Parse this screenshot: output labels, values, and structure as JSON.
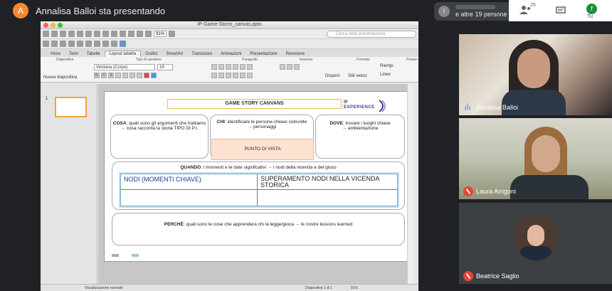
{
  "topbar": {
    "presenter_initial": "A",
    "presenter_text": "Annalisa Balloi sta presentando"
  },
  "app": {
    "window_title": "IP-Game-Storm_canvas.pptx",
    "zoom": "91%",
    "search_placeholder": "Cerca nella presentazione",
    "tabs": [
      "Inizio",
      "Temi",
      "Tabelle",
      "Layout tabella",
      "Grafici",
      "SmartArt",
      "Transizioni",
      "Animazioni",
      "Presentazione",
      "Revisione"
    ],
    "active_tab_index": 3,
    "ribbon": {
      "group_diapositive": "Diapositive",
      "group_carattere": "Tipo di carattere",
      "group_paragrafo": "Paragrafo",
      "group_inserisci": "Inserisci",
      "group_formato": "Formato",
      "group_presenta": "Presen",
      "font_name": "Verdana (Corpo)",
      "font_size": "19",
      "nuova_label": "Nuova diapositiva",
      "disponi_label": "Disponi",
      "stili_label": "Stili veloci",
      "riempi_label": "Riempi",
      "linee_label": "Linee"
    },
    "status": {
      "view": "Visualizzazione normale",
      "slide": "Diapositiva 1 di 1",
      "zoom": "91%"
    },
    "thumb_number": "1"
  },
  "slide": {
    "title": "GAME STORY CANVANS",
    "logo_line1": "IP",
    "logo_line2": "EXPERIENCE",
    "cosa_label": "COSA",
    "cosa_text": ": quali sono gli argomenti che trattiamo",
    "cosa_text2": "→ cosa racconta la storia TIPO DI P.I.",
    "chi_label": "CHI",
    "chi_text": ": identificare le persone chiave coinvolte",
    "chi_text2": "→ personaggi",
    "punto_di_vista": "PUNTO DI VISTA",
    "dove_label": "DOVE",
    "dove_text": ": trovare i luoghi chiave",
    "dove_text2": "→ ambientazione",
    "quando_label": "QUANDO",
    "quando_text": ": i momenti e le date significativi → i nodi della vicenda e del gioco",
    "table": {
      "cell_1": "NODI (MOMENTI CHIAVE)",
      "cell_2": "SUPERAMENTO NODI NELLA VICENDA STORICA"
    },
    "perche_label": "PERCHÉ",
    "perche_text": ": quali sono le cose che apprenderà chi la legge/gioca → le nostre lessons learned"
  },
  "meet": {
    "others_avatar": "I",
    "others_text": "e altre 19 persone",
    "participants_count": "25",
    "self_initial": "f",
    "self_label": "Tu",
    "tiles": [
      {
        "name": "Annalisa Balloi",
        "state": "speaking"
      },
      {
        "name": "Laura Arrigoni",
        "state": "muted"
      },
      {
        "name": "Beatrice Saglio",
        "state": "muted"
      }
    ],
    "colors": {
      "accent_green": "#1e8e3e",
      "muted_red": "#ea4335",
      "presenter_orange": "#f28b30"
    }
  }
}
